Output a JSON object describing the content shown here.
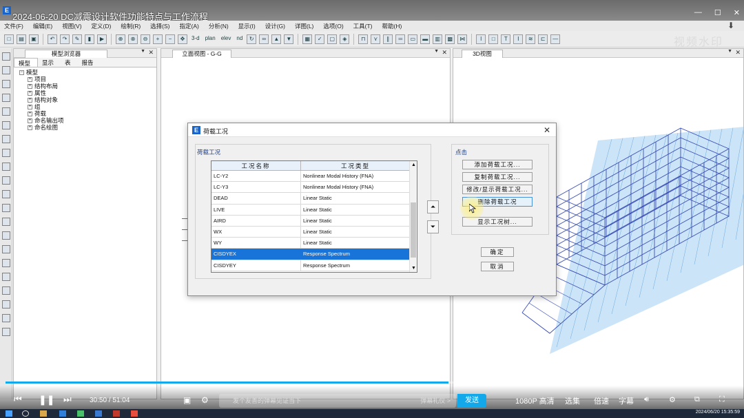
{
  "video_title": "2024-06-20 DC减震设计软件功能特点与工作流程",
  "menu": [
    "文件(F)",
    "编辑(E)",
    "视图(V)",
    "定义(D)",
    "绘制(R)",
    "选择(S)",
    "指定(A)",
    "分析(N)",
    "显示(I)",
    "设计(G)",
    "详图(L)",
    "选项(O)",
    "工具(T)",
    "帮助(H)"
  ],
  "toolbar_watermark": "视频水印",
  "toolbar_labels": {
    "view3d": "3-d",
    "plan": "plan",
    "elev": "elev",
    "nd": "nd"
  },
  "model_browser": {
    "title": "模型浏览器",
    "tabs": [
      "模型",
      "显示",
      "表",
      "报告"
    ],
    "root": "模型",
    "children": [
      "项目",
      "结构布局",
      "属性",
      "结构对象",
      "组",
      "荷载",
      "命名输出项",
      "命名绘图"
    ]
  },
  "elevation_view": {
    "title": "立面视图 - G-G"
  },
  "view3d": {
    "title": "3D视图"
  },
  "dialog": {
    "title": "荷载工况",
    "group_cases": "荷载工况",
    "group_click": "点击",
    "columns": [
      "工况名称",
      "工况类型"
    ],
    "rows": [
      {
        "name": "LC-Y2",
        "type": "Nonlinear Modal History (FNA)"
      },
      {
        "name": "LC-Y3",
        "type": "Nonlinear Modal History (FNA)"
      },
      {
        "name": "DEAD",
        "type": "Linear Static"
      },
      {
        "name": "LIVE",
        "type": "Linear Static"
      },
      {
        "name": "AIRD",
        "type": "Linear Static"
      },
      {
        "name": "WX",
        "type": "Linear Static"
      },
      {
        "name": "WY",
        "type": "Linear Static"
      },
      {
        "name": "CISDYEX",
        "type": "Response Spectrum"
      },
      {
        "name": "CISDYEY",
        "type": "Response Spectrum"
      }
    ],
    "selected_row": "CISDYEX",
    "buttons": {
      "add": "添加荷载工况...",
      "copy": "复制荷载工况...",
      "modify": "修改/显示荷载工况...",
      "delete": "删除荷载工况",
      "tree": "显示工况树...",
      "ok": "确定",
      "cancel": "取消"
    }
  },
  "player": {
    "current_time": "30:50",
    "total_time": "51:04",
    "time_display": "30:50 / 51:04",
    "progress_fraction": 0.604,
    "danmaku_placeholder": "发个友善的弹幕见证当下",
    "danmaku_etiquette": "弹幕礼仪 >",
    "send": "发送",
    "quality": "1080P 高清",
    "episodes": "选集",
    "speed": "倍速",
    "subtitle": "字幕"
  },
  "taskbar": {
    "clock": "2024/06/20 15:35:59"
  },
  "colors": {
    "accent": "#12a8ea",
    "selected_row": "#1874d8",
    "frame_blue": "#3a4fb8",
    "floor_blue": "#8fc4ee"
  }
}
